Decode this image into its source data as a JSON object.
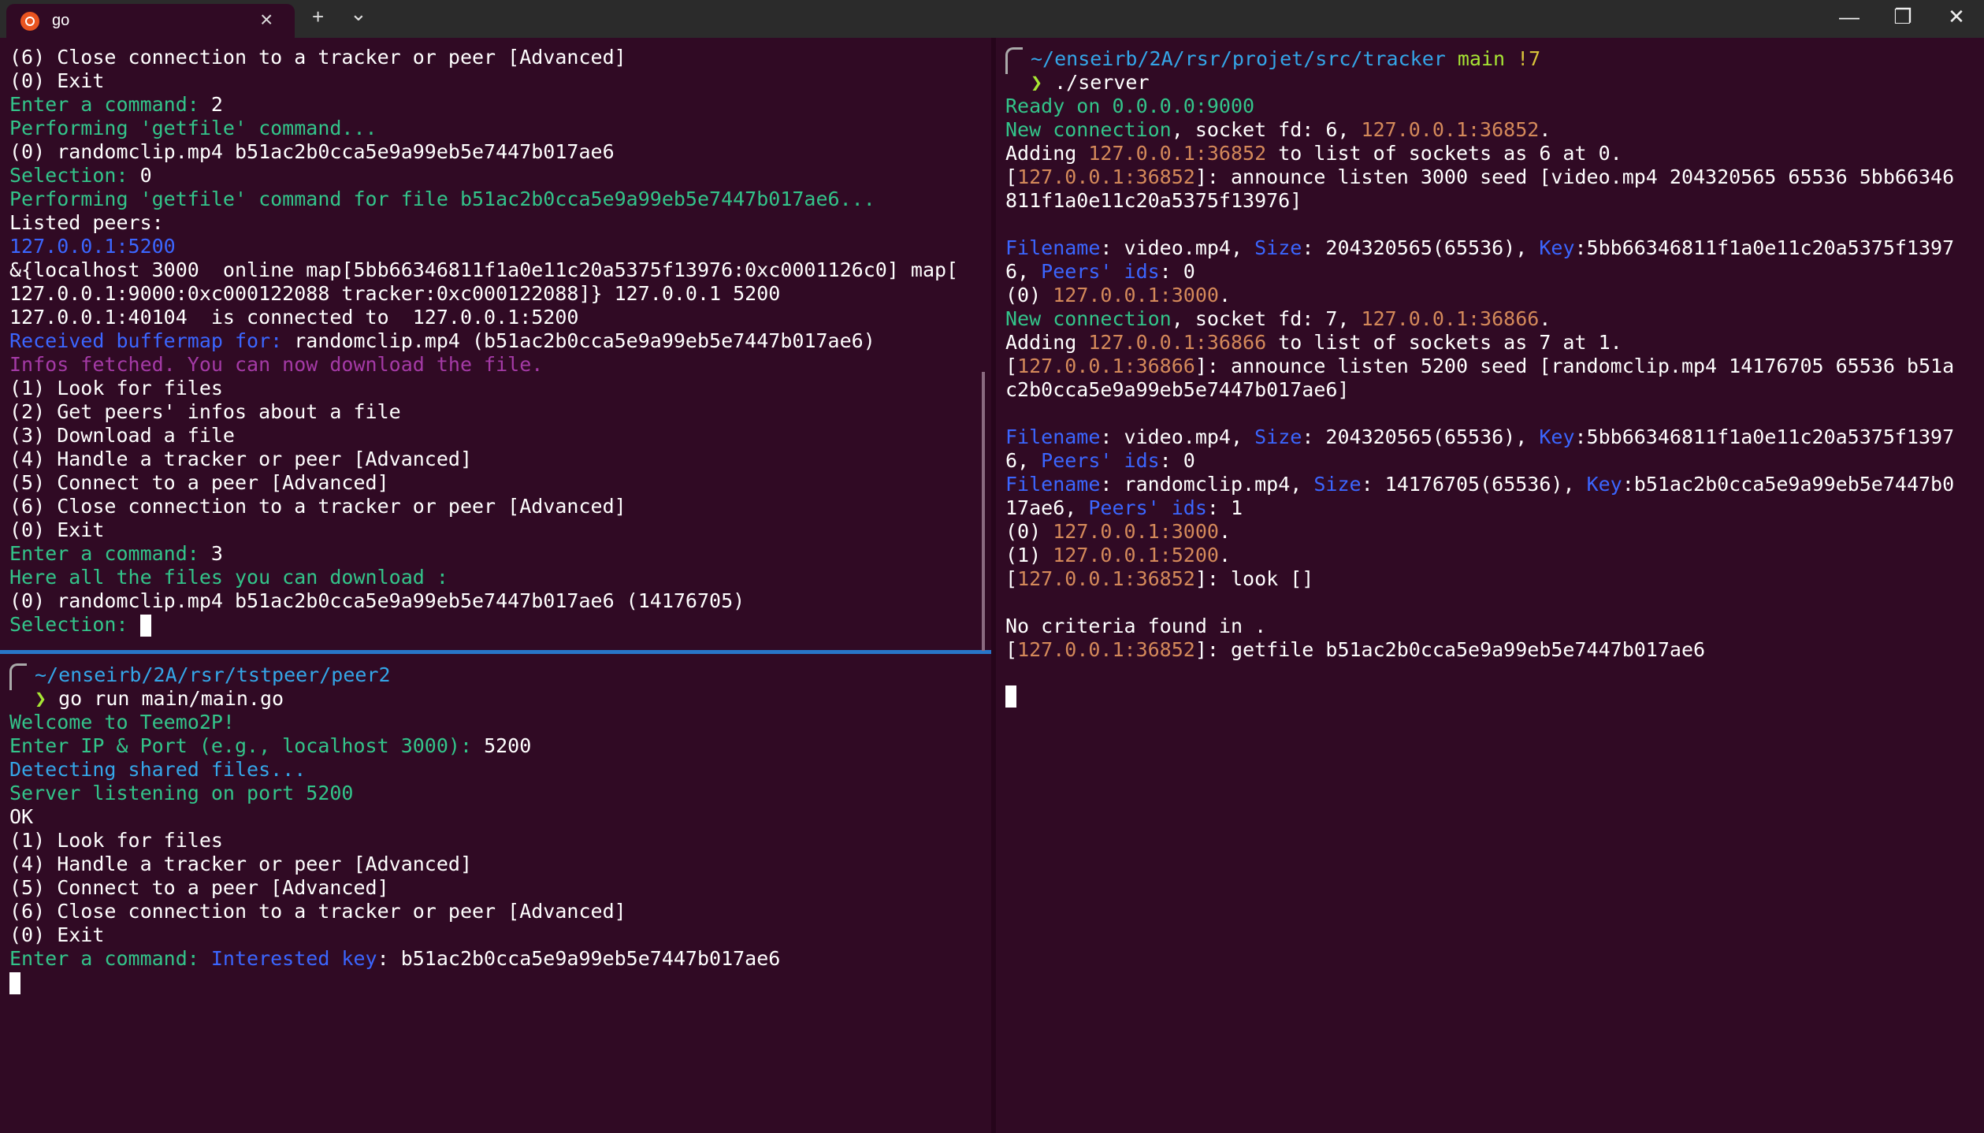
{
  "titlebar": {
    "tab_title": "go",
    "new_tab_label": "+",
    "dropdown_label": "⌄",
    "close_tab_label": "×",
    "minimize_label": "—",
    "maximize_label": "❐",
    "close_label": "✕"
  },
  "top_left": {
    "l1": "(6) Close connection to a tracker or peer [Advanced]",
    "l2": "(0) Exit",
    "l3_prompt": "Enter a command: ",
    "l3_val": "2",
    "l4": "Performing 'getfile' command...",
    "l5": "(0) randomclip.mp4 b51ac2b0cca5e9a99eb5e7447b017ae6",
    "l6_prompt": "Selection: ",
    "l6_val": "0",
    "l7": "Performing 'getfile' command for file b51ac2b0cca5e9a99eb5e7447b017ae6...",
    "l8": "Listed peers:",
    "l9": "127.0.0.1:5200",
    "l10": "&{localhost 3000  online map[5bb66346811f1a0e11c20a5375f13976:0xc0001126c0] map[",
    "l11": "127.0.0.1:9000:0xc000122088 tracker:0xc000122088]} 127.0.0.1 5200",
    "l12": "127.0.0.1:40104  is connected to  127.0.0.1:5200",
    "l13_a": "Received buffermap for: ",
    "l13_b": "randomclip.mp4 (b51ac2b0cca5e9a99eb5e7447b017ae6)",
    "l14": "Infos fetched. You can now download the file.",
    "l15": "(1) Look for files",
    "l16": "(2) Get peers' infos about a file",
    "l17": "(3) Download a file",
    "l18": "(4) Handle a tracker or peer [Advanced]",
    "l19": "(5) Connect to a peer [Advanced]",
    "l20": "(6) Close connection to a tracker or peer [Advanced]",
    "l21": "(0) Exit",
    "l22_prompt": "Enter a command: ",
    "l22_val": "3",
    "l23": "Here all the files you can download :",
    "l24": "(0) randomclip.mp4 b51ac2b0cca5e9a99eb5e7447b017ae6 (14176705)",
    "l25_prompt": "Selection: "
  },
  "bottom_left": {
    "path": "~/enseirb/2A/rsr/tstpeer/",
    "path_end": "peer2",
    "cmd_arrow": "❯",
    "cmd": " go run main/main.go",
    "l1": "Welcome to Teemo2P!",
    "l2_prompt": "Enter IP & Port (e.g., localhost 3000): ",
    "l2_val": "5200",
    "l3": "Detecting shared files...",
    "l4": "Server listening on port 5200",
    "l5": "OK",
    "l6": "(1) Look for files",
    "l7": "(4) Handle a tracker or peer [Advanced]",
    "l8": "(5) Connect to a peer [Advanced]",
    "l9": "(6) Close connection to a tracker or peer [Advanced]",
    "l10": "(0) Exit",
    "l11_prompt": "Enter a command: ",
    "l11_key": "Interested key",
    "l11_rest": ": b51ac2b0cca5e9a99eb5e7447b017ae6"
  },
  "right": {
    "path": "~/enseirb/2A/rsr/",
    "path_mid": "projet",
    "path_rest": "/src/",
    "path_end": "tracker",
    "branch": " main",
    "branch_status": " !7",
    "cmd_arrow": "❯",
    "cmd": " ./server",
    "l1": "Ready on 0.0.0.0:9000",
    "l2_a": "New connection",
    "l2_b": ", socket fd: 6, ",
    "l2_c": "127.0.0.1:36852",
    "l2_d": ".",
    "l3_a": "Adding ",
    "l3_b": "127.0.0.1:36852",
    "l3_c": " to list of sockets as 6 at 0.",
    "l4_a": "[",
    "l4_b": "127.0.0.1:36852",
    "l4_c": "]: announce listen 3000 seed [video.mp4 204320565 65536 5bb66346",
    "l5": "811f1a0e11c20a5375f13976]",
    "l6_k1": "Filename",
    "l6_v1": ": video.mp4, ",
    "l6_k2": "Size",
    "l6_v2": ": 204320565(65536), ",
    "l6_k3": "Key",
    "l6_v3": ":5bb66346811f1a0e11c20a5375f1397",
    "l7_a": "6, ",
    "l7_k": "Peers' ids",
    "l7_v": ": 0",
    "l8_a": "(0) ",
    "l8_b": "127.0.0.1:3000",
    "l8_c": ".",
    "l9_a": "New connection",
    "l9_b": ", socket fd: 7, ",
    "l9_c": "127.0.0.1:36866",
    "l9_d": ".",
    "l10_a": "Adding ",
    "l10_b": "127.0.0.1:36866",
    "l10_c": " to list of sockets as 7 at 1.",
    "l11_a": "[",
    "l11_b": "127.0.0.1:36866",
    "l11_c": "]: announce listen 5200 seed [randomclip.mp4 14176705 65536 b51a",
    "l12": "c2b0cca5e9a99eb5e7447b017ae6]",
    "l13_k1": "Filename",
    "l13_v1": ": video.mp4, ",
    "l13_k2": "Size",
    "l13_v2": ": 204320565(65536), ",
    "l13_k3": "Key",
    "l13_v3": ":5bb66346811f1a0e11c20a5375f1397",
    "l14_a": "6, ",
    "l14_k": "Peers' ids",
    "l14_v": ": 0",
    "l15_k1": "Filename",
    "l15_v1": ": randomclip.mp4, ",
    "l15_k2": "Size",
    "l15_v2": ": 14176705(65536), ",
    "l15_k3": "Key",
    "l15_v3": ":b51ac2b0cca5e9a99eb5e7447b0",
    "l16_a": "17ae6, ",
    "l16_k": "Peers' ids",
    "l16_v": ": 1",
    "l17_a": "(0) ",
    "l17_b": "127.0.0.1:3000",
    "l17_c": ".",
    "l18_a": "(1) ",
    "l18_b": "127.0.0.1:5200",
    "l18_c": ".",
    "l19_a": "[",
    "l19_b": "127.0.0.1:36852",
    "l19_c": "]: look []",
    "l20": "No criteria found in .",
    "l21_a": "[",
    "l21_b": "127.0.0.1:36852",
    "l21_c": "]: getfile b51ac2b0cca5e9a99eb5e7447b017ae6"
  }
}
